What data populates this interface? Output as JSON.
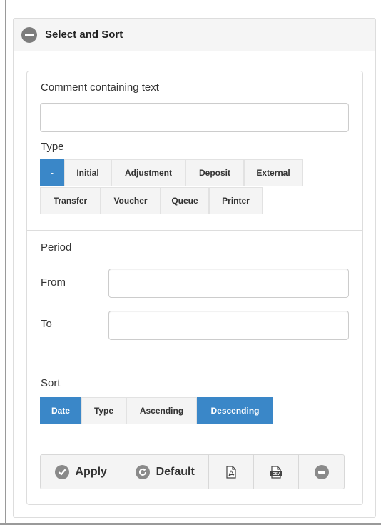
{
  "panel": {
    "title": "Select and Sort"
  },
  "comment": {
    "label": "Comment containing text",
    "value": "",
    "placeholder": ""
  },
  "type": {
    "label": "Type",
    "row1": [
      "-",
      "Initial",
      "Adjustment",
      "Deposit",
      "External"
    ],
    "row2": [
      "Transfer",
      "Voucher",
      "Queue",
      "Printer"
    ],
    "selected": "-"
  },
  "period": {
    "label": "Period",
    "from_label": "From",
    "from_value": "",
    "to_label": "To",
    "to_value": ""
  },
  "sort": {
    "label": "Sort",
    "options": [
      "Date",
      "Type",
      "Ascending",
      "Descending"
    ],
    "active": [
      "Date",
      "Descending"
    ]
  },
  "toolbar": {
    "apply_label": "Apply",
    "default_label": "Default",
    "pdf_icon": "pdf-file-icon",
    "csv_icon": "csv-file-icon",
    "remove_icon": "minus-circle-icon"
  },
  "colors": {
    "accent": "#3a87c8",
    "icon_gray": "#8a8a8a",
    "button_bg": "#f4f4f4"
  }
}
